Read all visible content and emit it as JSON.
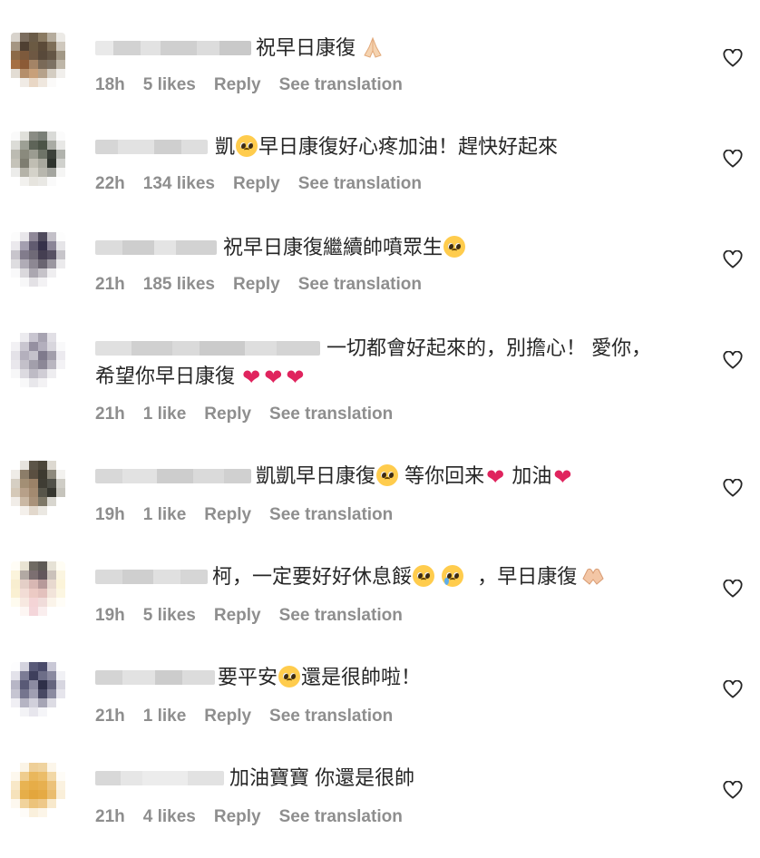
{
  "comments": [
    {
      "text_before": "祝早日康復",
      "emoji": "folded-hands",
      "text_after": "",
      "time": "18h",
      "likes": "5 likes",
      "reply": "Reply",
      "translate": "See translation"
    },
    {
      "text_before": "凱",
      "emoji": "pleading-face",
      "text_after": "早日康復好心疼加油！趕快好起來",
      "time": "22h",
      "likes": "134 likes",
      "reply": "Reply",
      "translate": "See translation"
    },
    {
      "text_before": "祝早日康復繼續帥噴眾生",
      "emoji": "pleading-face",
      "text_after": "",
      "time": "21h",
      "likes": "185 likes",
      "reply": "Reply",
      "translate": "See translation"
    },
    {
      "text_before": "一切都會好起來的，別擔心！ 愛你，",
      "line2": "希望你早日康復",
      "emoji": "red-hearts",
      "time": "21h",
      "likes": "1 like",
      "reply": "Reply",
      "translate": "See translation"
    },
    {
      "text_before": "凱凱早日康復",
      "text_mid": "等你回来",
      "text_after": "加油",
      "emoji": "pleading-face-red-hearts",
      "time": "19h",
      "likes": "1 like",
      "reply": "Reply",
      "translate": "See translation"
    },
    {
      "text_before": "柯，一定要好好休息餒",
      "text_after": "，早日康復",
      "emoji": "pleading-crying-hand-heart",
      "time": "19h",
      "likes": "5 likes",
      "reply": "Reply",
      "translate": "See translation"
    },
    {
      "text_before": "要平安",
      "text_after": "還是很帥啦！",
      "emoji": "pleading-face",
      "time": "21h",
      "likes": "1 like",
      "reply": "Reply",
      "translate": "See translation"
    },
    {
      "text_before": "加油寶寶 你還是很帥",
      "time": "21h",
      "likes": "4 likes",
      "reply": "Reply",
      "translate": "See translation"
    }
  ],
  "icons": {
    "like": "heart-outline-icon"
  },
  "colors": {
    "text": "#262626",
    "meta": "#8e8e8e",
    "heart_red": "#e0245e"
  }
}
